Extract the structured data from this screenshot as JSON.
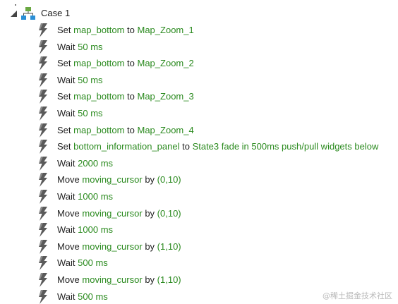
{
  "case": {
    "label": "Case 1",
    "expander_icon": "triangle-expanded-icon",
    "icon": "sitemap-icon"
  },
  "action_icon": "lightning-bolt-icon",
  "actions": [
    {
      "verb": "Set",
      "target": "map_bottom",
      "middle": "to",
      "value": "Map_Zoom_1"
    },
    {
      "verb": "Wait",
      "target": "",
      "middle": "",
      "value": "50 ms"
    },
    {
      "verb": "Set",
      "target": "map_bottom",
      "middle": "to",
      "value": "Map_Zoom_2"
    },
    {
      "verb": "Wait",
      "target": "",
      "middle": "",
      "value": "50 ms"
    },
    {
      "verb": "Set",
      "target": "map_bottom",
      "middle": "to",
      "value": "Map_Zoom_3"
    },
    {
      "verb": "Wait",
      "target": "",
      "middle": "",
      "value": "50 ms"
    },
    {
      "verb": "Set",
      "target": "map_bottom",
      "middle": "to",
      "value": "Map_Zoom_4"
    },
    {
      "verb": "Set",
      "target": "bottom_information_panel",
      "middle": "to",
      "value": "State3 fade in 500ms push/pull widgets below"
    },
    {
      "verb": "Wait",
      "target": "",
      "middle": "",
      "value": "2000 ms"
    },
    {
      "verb": "Move",
      "target": "moving_cursor",
      "middle": "by",
      "value": "(0,10)"
    },
    {
      "verb": "Wait",
      "target": "",
      "middle": "",
      "value": "1000 ms"
    },
    {
      "verb": "Move",
      "target": "moving_cursor",
      "middle": "by",
      "value": "(0,10)"
    },
    {
      "verb": "Wait",
      "target": "",
      "middle": "",
      "value": "1000 ms"
    },
    {
      "verb": "Move",
      "target": "moving_cursor",
      "middle": "by",
      "value": "(1,10)"
    },
    {
      "verb": "Wait",
      "target": "",
      "middle": "",
      "value": "500 ms"
    },
    {
      "verb": "Move",
      "target": "moving_cursor",
      "middle": "by",
      "value": "(1,10)"
    },
    {
      "verb": "Wait",
      "target": "",
      "middle": "",
      "value": "500 ms"
    }
  ],
  "watermark": "@稀土掘金技术社区",
  "colors": {
    "param": "#2a8a1e",
    "text": "#1f1f1f",
    "bolt": "#5a5a5a",
    "sitemap_top": "#6aa842",
    "sitemap_bottom": "#2b8fd6"
  }
}
